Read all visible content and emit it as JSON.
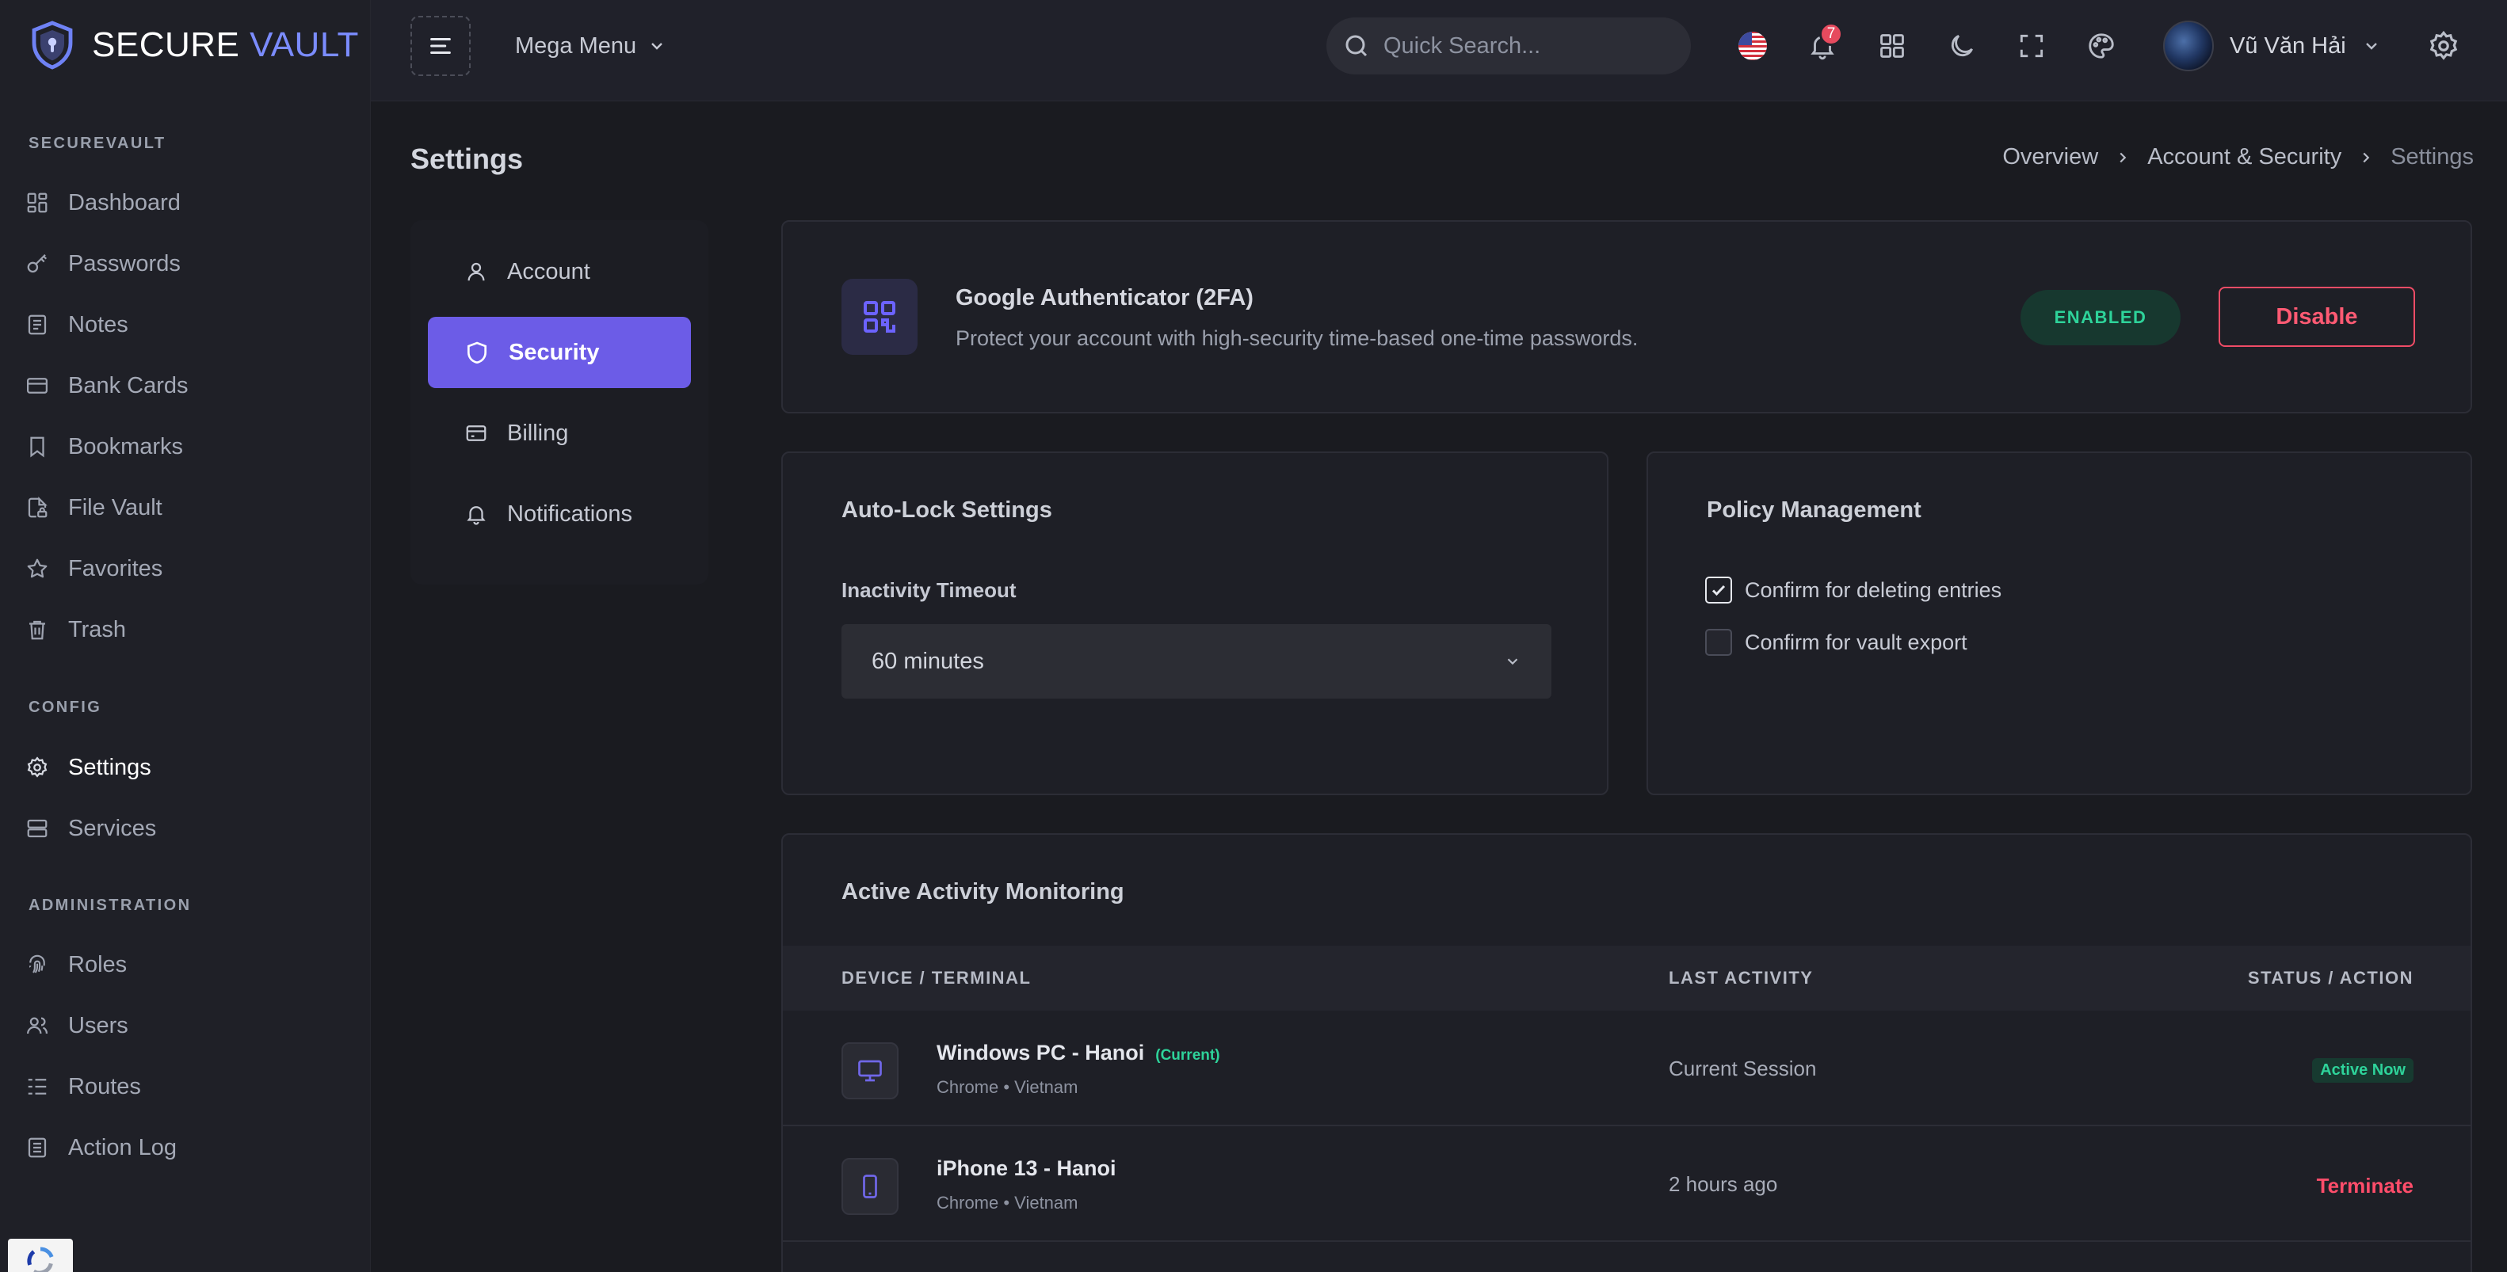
{
  "brand": {
    "name_main": "SECURE",
    "name_accent": "VAULT"
  },
  "sidebar": {
    "sections": [
      {
        "title": "SECUREVAULT"
      },
      {
        "title": "CONFIG"
      },
      {
        "title": "ADMINISTRATION"
      }
    ],
    "items": [
      {
        "label": "Dashboard"
      },
      {
        "label": "Passwords"
      },
      {
        "label": "Notes"
      },
      {
        "label": "Bank Cards"
      },
      {
        "label": "Bookmarks"
      },
      {
        "label": "File Vault"
      },
      {
        "label": "Favorites"
      },
      {
        "label": "Trash"
      },
      {
        "label": "Settings"
      },
      {
        "label": "Services"
      },
      {
        "label": "Roles"
      },
      {
        "label": "Users"
      },
      {
        "label": "Routes"
      },
      {
        "label": "Action Log"
      }
    ],
    "active_item": "Settings"
  },
  "header": {
    "mega_menu_label": "Mega Menu",
    "search_placeholder": "Quick Search...",
    "notification_count": "7",
    "user_name": "Vũ Văn Hải"
  },
  "page": {
    "title": "Settings",
    "breadcrumb": [
      "Overview",
      "Account & Security",
      "Settings"
    ]
  },
  "subnav": {
    "items": [
      {
        "label": "Account"
      },
      {
        "label": "Security"
      },
      {
        "label": "Billing"
      },
      {
        "label": "Notifications"
      }
    ],
    "active_item": "Security"
  },
  "twofa": {
    "title": "Google Authenticator (2FA)",
    "description": "Protect your account with high-security time-based one-time passwords.",
    "status": "ENABLED",
    "action_label": "Disable"
  },
  "autolock": {
    "title": "Auto-Lock Settings",
    "field_label": "Inactivity Timeout",
    "selected_value": "60 minutes"
  },
  "policy": {
    "title": "Policy Management",
    "options": [
      {
        "label": "Confirm for deleting entries",
        "checked": true
      },
      {
        "label": "Confirm for vault export",
        "checked": false
      }
    ]
  },
  "activity": {
    "title": "Active Activity Monitoring",
    "columns": [
      "DEVICE / TERMINAL",
      "LAST ACTIVITY",
      "STATUS / ACTION"
    ],
    "rows": [
      {
        "device": "Windows PC - Hanoi",
        "tag": "(Current)",
        "meta": "Chrome • Vietnam",
        "last_activity": "Current Session",
        "status": "Active Now",
        "icon": "monitor-icon"
      },
      {
        "device": "iPhone 13 - Hanoi",
        "tag": "",
        "meta": "Chrome • Vietnam",
        "last_activity": "2 hours ago",
        "status": "Terminate",
        "icon": "smartphone-icon"
      }
    ]
  },
  "colors": {
    "accent": "#6c5ce7",
    "brand_accent": "#7b8cff",
    "success": "#2ed39a",
    "danger": "#ff4d6a",
    "background": "#1a1b20"
  }
}
